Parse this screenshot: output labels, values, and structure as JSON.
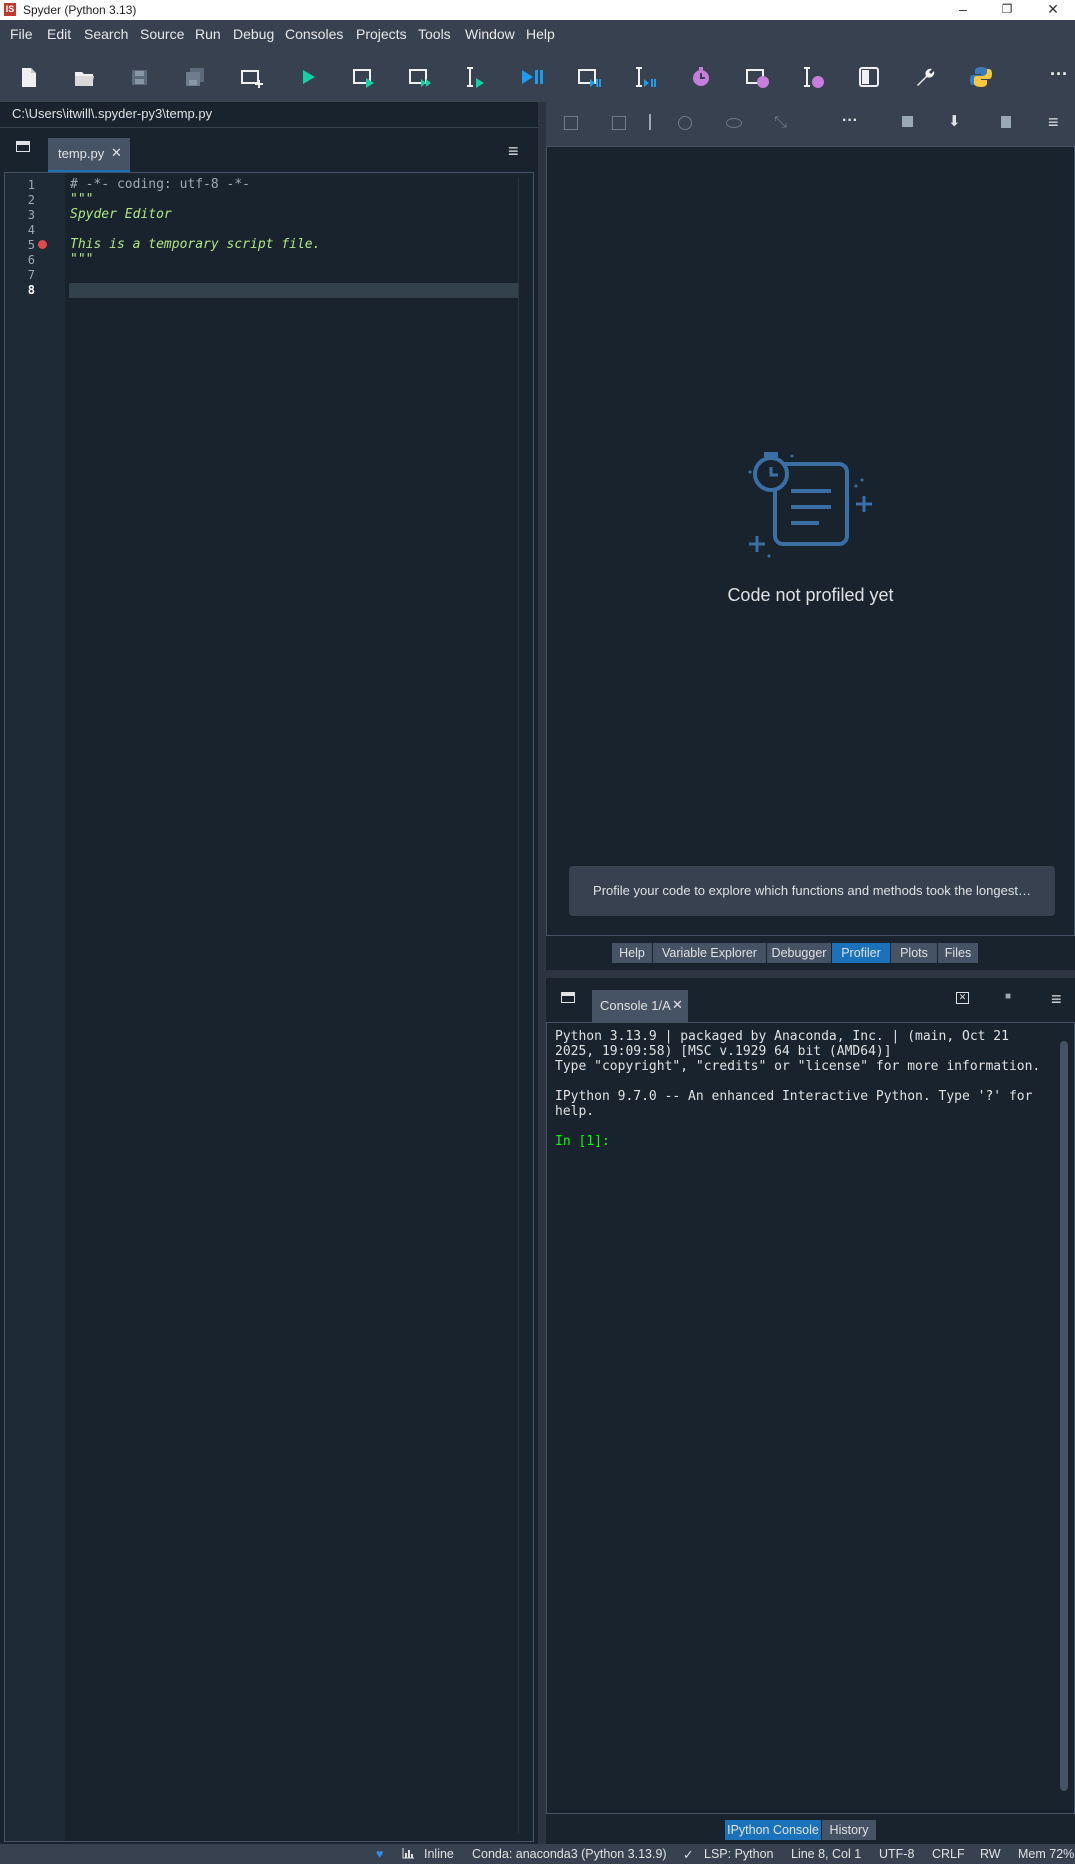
{
  "window": {
    "title": "Spyder (Python 3.13)",
    "logo_text": "IS",
    "controls": [
      "–",
      "❐",
      "✕"
    ]
  },
  "menu": [
    "File",
    "Edit",
    "Search",
    "Source",
    "Run",
    "Debug",
    "Consoles",
    "Projects",
    "Tools",
    "Window",
    "Help"
  ],
  "toolbar": {
    "more_label": "···"
  },
  "editor": {
    "path": "C:\\Users\\itwill\\.spyder-py3\\temp.py",
    "tab_label": "temp.py",
    "tab_close": "✕",
    "menu_icon": "≡",
    "current_line": "8",
    "breakpoint_line": 5,
    "lines": [
      {
        "no": "1",
        "text": "# -*- coding: utf-8 -*-",
        "style": "comment"
      },
      {
        "no": "2",
        "text": "\"\"\"",
        "style": "string"
      },
      {
        "no": "3",
        "text": "Spyder Editor",
        "style": "docstring"
      },
      {
        "no": "4",
        "text": "",
        "style": "plain"
      },
      {
        "no": "5",
        "text": "This is a temporary script file.",
        "style": "docstring"
      },
      {
        "no": "6",
        "text": "\"\"\"",
        "style": "string"
      },
      {
        "no": "7",
        "text": "",
        "style": "plain"
      },
      {
        "no": "8",
        "text": "",
        "style": "plain"
      }
    ]
  },
  "profiler": {
    "empty_message": "Code not profiled yet",
    "hint": "Profile your code to explore which functions and methods took the longest…",
    "toolbar_more": "···",
    "menu_icon": "≡"
  },
  "right_tabs": [
    {
      "label": "Help",
      "active": false
    },
    {
      "label": "Variable Explorer",
      "active": false
    },
    {
      "label": "Debugger",
      "active": false
    },
    {
      "label": "Profiler",
      "active": true
    },
    {
      "label": "Plots",
      "active": false
    },
    {
      "label": "Files",
      "active": false
    }
  ],
  "console": {
    "tab_label": "Console 1/A",
    "tab_close": "✕",
    "menu_icon": "≡",
    "stop_icon": "■",
    "lines": [
      "Python 3.13.9 | packaged by Anaconda, Inc. | (main, Oct 21",
      "2025, 19:09:58) [MSC v.1929 64 bit (AMD64)]",
      "Type \"copyright\", \"credits\" or \"license\" for more information.",
      "",
      "IPython 9.7.0 -- An enhanced Interactive Python. Type '?' for",
      "help."
    ],
    "prompt": "In [1]:"
  },
  "console_bottom_tabs": [
    {
      "label": "IPython Console",
      "active": true
    },
    {
      "label": "History",
      "active": false
    }
  ],
  "status": {
    "inline": "Inline",
    "conda": "Conda: anaconda3 (Python 3.13.9)",
    "lsp": "LSP: Python",
    "position": "Line 8, Col 1",
    "encoding": "UTF-8",
    "eol": "CRLF",
    "permissions": "RW",
    "memory": "Mem 72%"
  },
  "colors": {
    "accent": "#1a72bb",
    "comment": "#9da9b5",
    "string": "#b0e686",
    "prompt": "#00ff00",
    "breakpoint": "#e24a4a",
    "profiler_icon": "#3a6ea5"
  }
}
